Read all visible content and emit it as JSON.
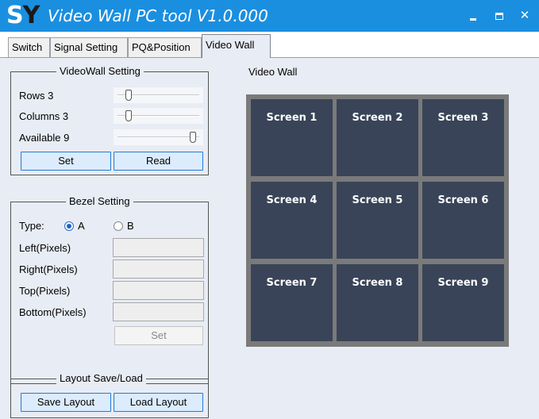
{
  "titlebar": {
    "logo_s": "S",
    "logo_y": "Y",
    "title": "Video Wall PC tool V1.0.000",
    "close_glyph": "✕"
  },
  "tabs": [
    {
      "label": "Switch"
    },
    {
      "label": "Signal Setting"
    },
    {
      "label": "PQ&Position"
    },
    {
      "label": "Video Wall",
      "active": true
    }
  ],
  "videowall_setting": {
    "title": "VideoWall Setting",
    "rows_label": "Rows 3",
    "rows_value": 3,
    "columns_label": "Columns 3",
    "columns_value": 3,
    "available_label": "Available 9",
    "available_value": 9,
    "set_button": "Set",
    "read_button": "Read"
  },
  "bezel_setting": {
    "title": "Bezel Setting",
    "type_label": "Type:",
    "option_a": "A",
    "option_b": "B",
    "selected": "A",
    "left_label": "Left(Pixels)",
    "left_value": "",
    "right_label": "Right(Pixels)",
    "right_value": "",
    "top_label": "Top(Pixels)",
    "top_value": "",
    "bottom_label": "Bottom(Pixels)",
    "bottom_value": "",
    "set_button": "Set"
  },
  "layout": {
    "title": "Layout Save/Load",
    "save_button": "Save Layout",
    "load_button": "Load Layout"
  },
  "video_wall": {
    "label": "Video Wall",
    "screens": [
      "Screen 1",
      "Screen 2",
      "Screen 3",
      "Screen 4",
      "Screen 5",
      "Screen 6",
      "Screen 7",
      "Screen 8",
      "Screen 9"
    ]
  },
  "colors": {
    "titlebar": "#1a8fe0",
    "screen_fill": "#394458",
    "wall_frame": "#7a7a7a",
    "button_fill": "#dcecfc",
    "button_border": "#2a7fd4"
  }
}
